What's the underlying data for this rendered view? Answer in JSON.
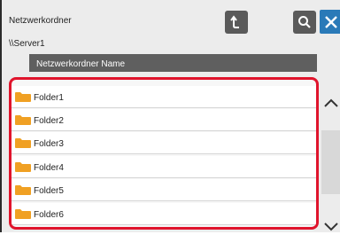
{
  "header": {
    "title": "Netzwerkordner",
    "refresh_icon": "refresh-icon",
    "search_icon": "search-icon",
    "close_icon": "close-icon"
  },
  "path": "\\\\Server1",
  "list": {
    "column_header": "Netzwerkordner Name",
    "items": [
      {
        "label": "Folder1",
        "icon": "folder-icon"
      },
      {
        "label": "Folder2",
        "icon": "folder-icon"
      },
      {
        "label": "Folder3",
        "icon": "folder-icon"
      },
      {
        "label": "Folder4",
        "icon": "folder-icon"
      },
      {
        "label": "Folder5",
        "icon": "folder-icon"
      },
      {
        "label": "Folder6",
        "icon": "folder-icon"
      }
    ]
  },
  "colors": {
    "highlight": "#e0142c",
    "close_button": "#2a7ab8",
    "folder": "#f0a023",
    "header_bar": "#5f5f5f"
  }
}
